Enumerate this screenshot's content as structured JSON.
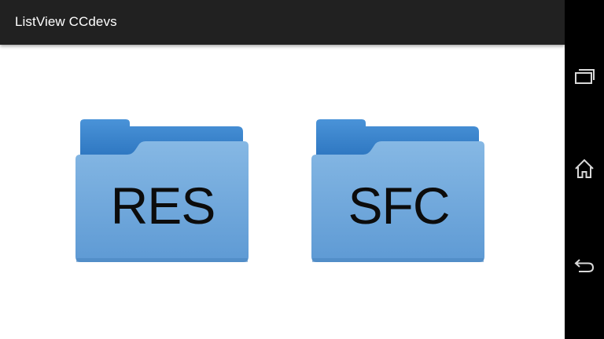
{
  "app": {
    "title": "ListView CCdevs"
  },
  "folders": [
    {
      "label": "RES"
    },
    {
      "label": "SFC"
    }
  ],
  "nav": {
    "buttons": [
      "recent-apps-icon",
      "home-icon",
      "back-icon"
    ]
  },
  "colors": {
    "action_bar": "#212121",
    "folder_front": "#6fa8dc",
    "folder_back": "#3a86cf",
    "nav_bar": "#000000"
  }
}
